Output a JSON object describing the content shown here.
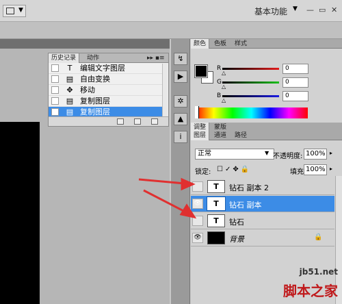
{
  "topbar": {
    "workspace_label": "基本功能",
    "workspace_arrow": "▼",
    "menu_arrow": "▼",
    "min": "—",
    "restore": "▭",
    "close": "✕"
  },
  "history_panel": {
    "tabs": [
      "历史记录",
      "动作"
    ],
    "menu": "▸▸ ▪≡",
    "items": [
      {
        "icon": "T",
        "label": "编辑文字图层"
      },
      {
        "icon": "▤",
        "label": "自由变换"
      },
      {
        "icon": "✥",
        "label": "移动"
      },
      {
        "icon": "▤",
        "label": "复制图层"
      },
      {
        "icon": "▤",
        "label": "复制图层",
        "selected": true
      }
    ]
  },
  "color_panel": {
    "tabs": [
      "颜色",
      "色板",
      "样式"
    ],
    "sliders": [
      {
        "label": "R",
        "value": "0",
        "color": "#e31b1b"
      },
      {
        "label": "G",
        "value": "0",
        "color": "#1bbf1b"
      },
      {
        "label": "B",
        "value": "0",
        "color": "#1b1be3"
      }
    ]
  },
  "adjust_tabs": [
    "调整",
    "蒙版"
  ],
  "layers_panel": {
    "tabs": [
      "图层",
      "通道",
      "路径"
    ],
    "blend_mode": "正常",
    "opacity_label": "不透明度:",
    "opacity_value": "100%",
    "lock_label": "锁定:",
    "lock_icons": "☐✓✥🔒",
    "fill_label": "填充:",
    "fill_value": "100%",
    "layers": [
      {
        "name": "钻石 副本 2",
        "thumb": "T",
        "visible": false,
        "selected": false
      },
      {
        "name": "钻石 副本",
        "thumb": "T",
        "visible": true,
        "selected": true
      },
      {
        "name": "钻石",
        "thumb": "T",
        "visible": false,
        "selected": false
      },
      {
        "name": "背景",
        "thumb": "",
        "visible": true,
        "selected": false,
        "locked": true
      }
    ]
  },
  "icon_strip": [
    "↯",
    "▶",
    "✲",
    "▲",
    "i"
  ],
  "watermark": {
    "line1": "jb51.net",
    "line2": "脚本之家"
  },
  "colors": {
    "selection": "#3c8ce6",
    "arrow": "#e03030"
  }
}
